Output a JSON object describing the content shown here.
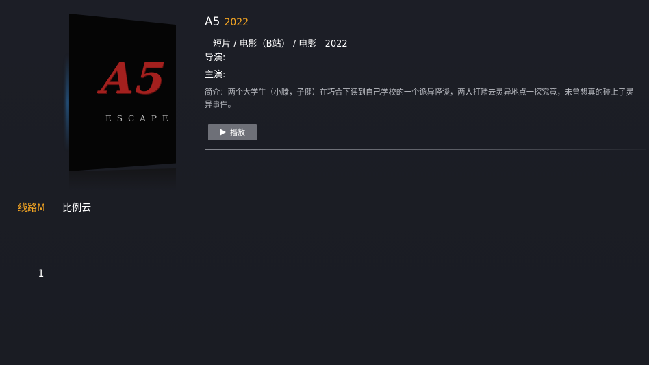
{
  "poster": {
    "title": "A5",
    "subtitle": "ESCAPE"
  },
  "detail": {
    "title": "A5",
    "year": "2022",
    "meta": "短片 / 电影（B站） / 电影   2022",
    "director": "导演:",
    "actors": "主演:",
    "description": "简介：两个大学生（小滕，子健）在巧合下读到自己学校的一个诡异怪谈，两人打赌去灵异地点一探究竟，未曾想真的碰上了灵异事件。",
    "play_label": "播放"
  },
  "sources": [
    {
      "label": "线路M",
      "active": true
    },
    {
      "label": "比例云",
      "active": false
    }
  ],
  "episodes": [
    "1"
  ],
  "colors": {
    "accent": "#f5a623",
    "background": "#1b1d24",
    "button": "#6e7078"
  }
}
